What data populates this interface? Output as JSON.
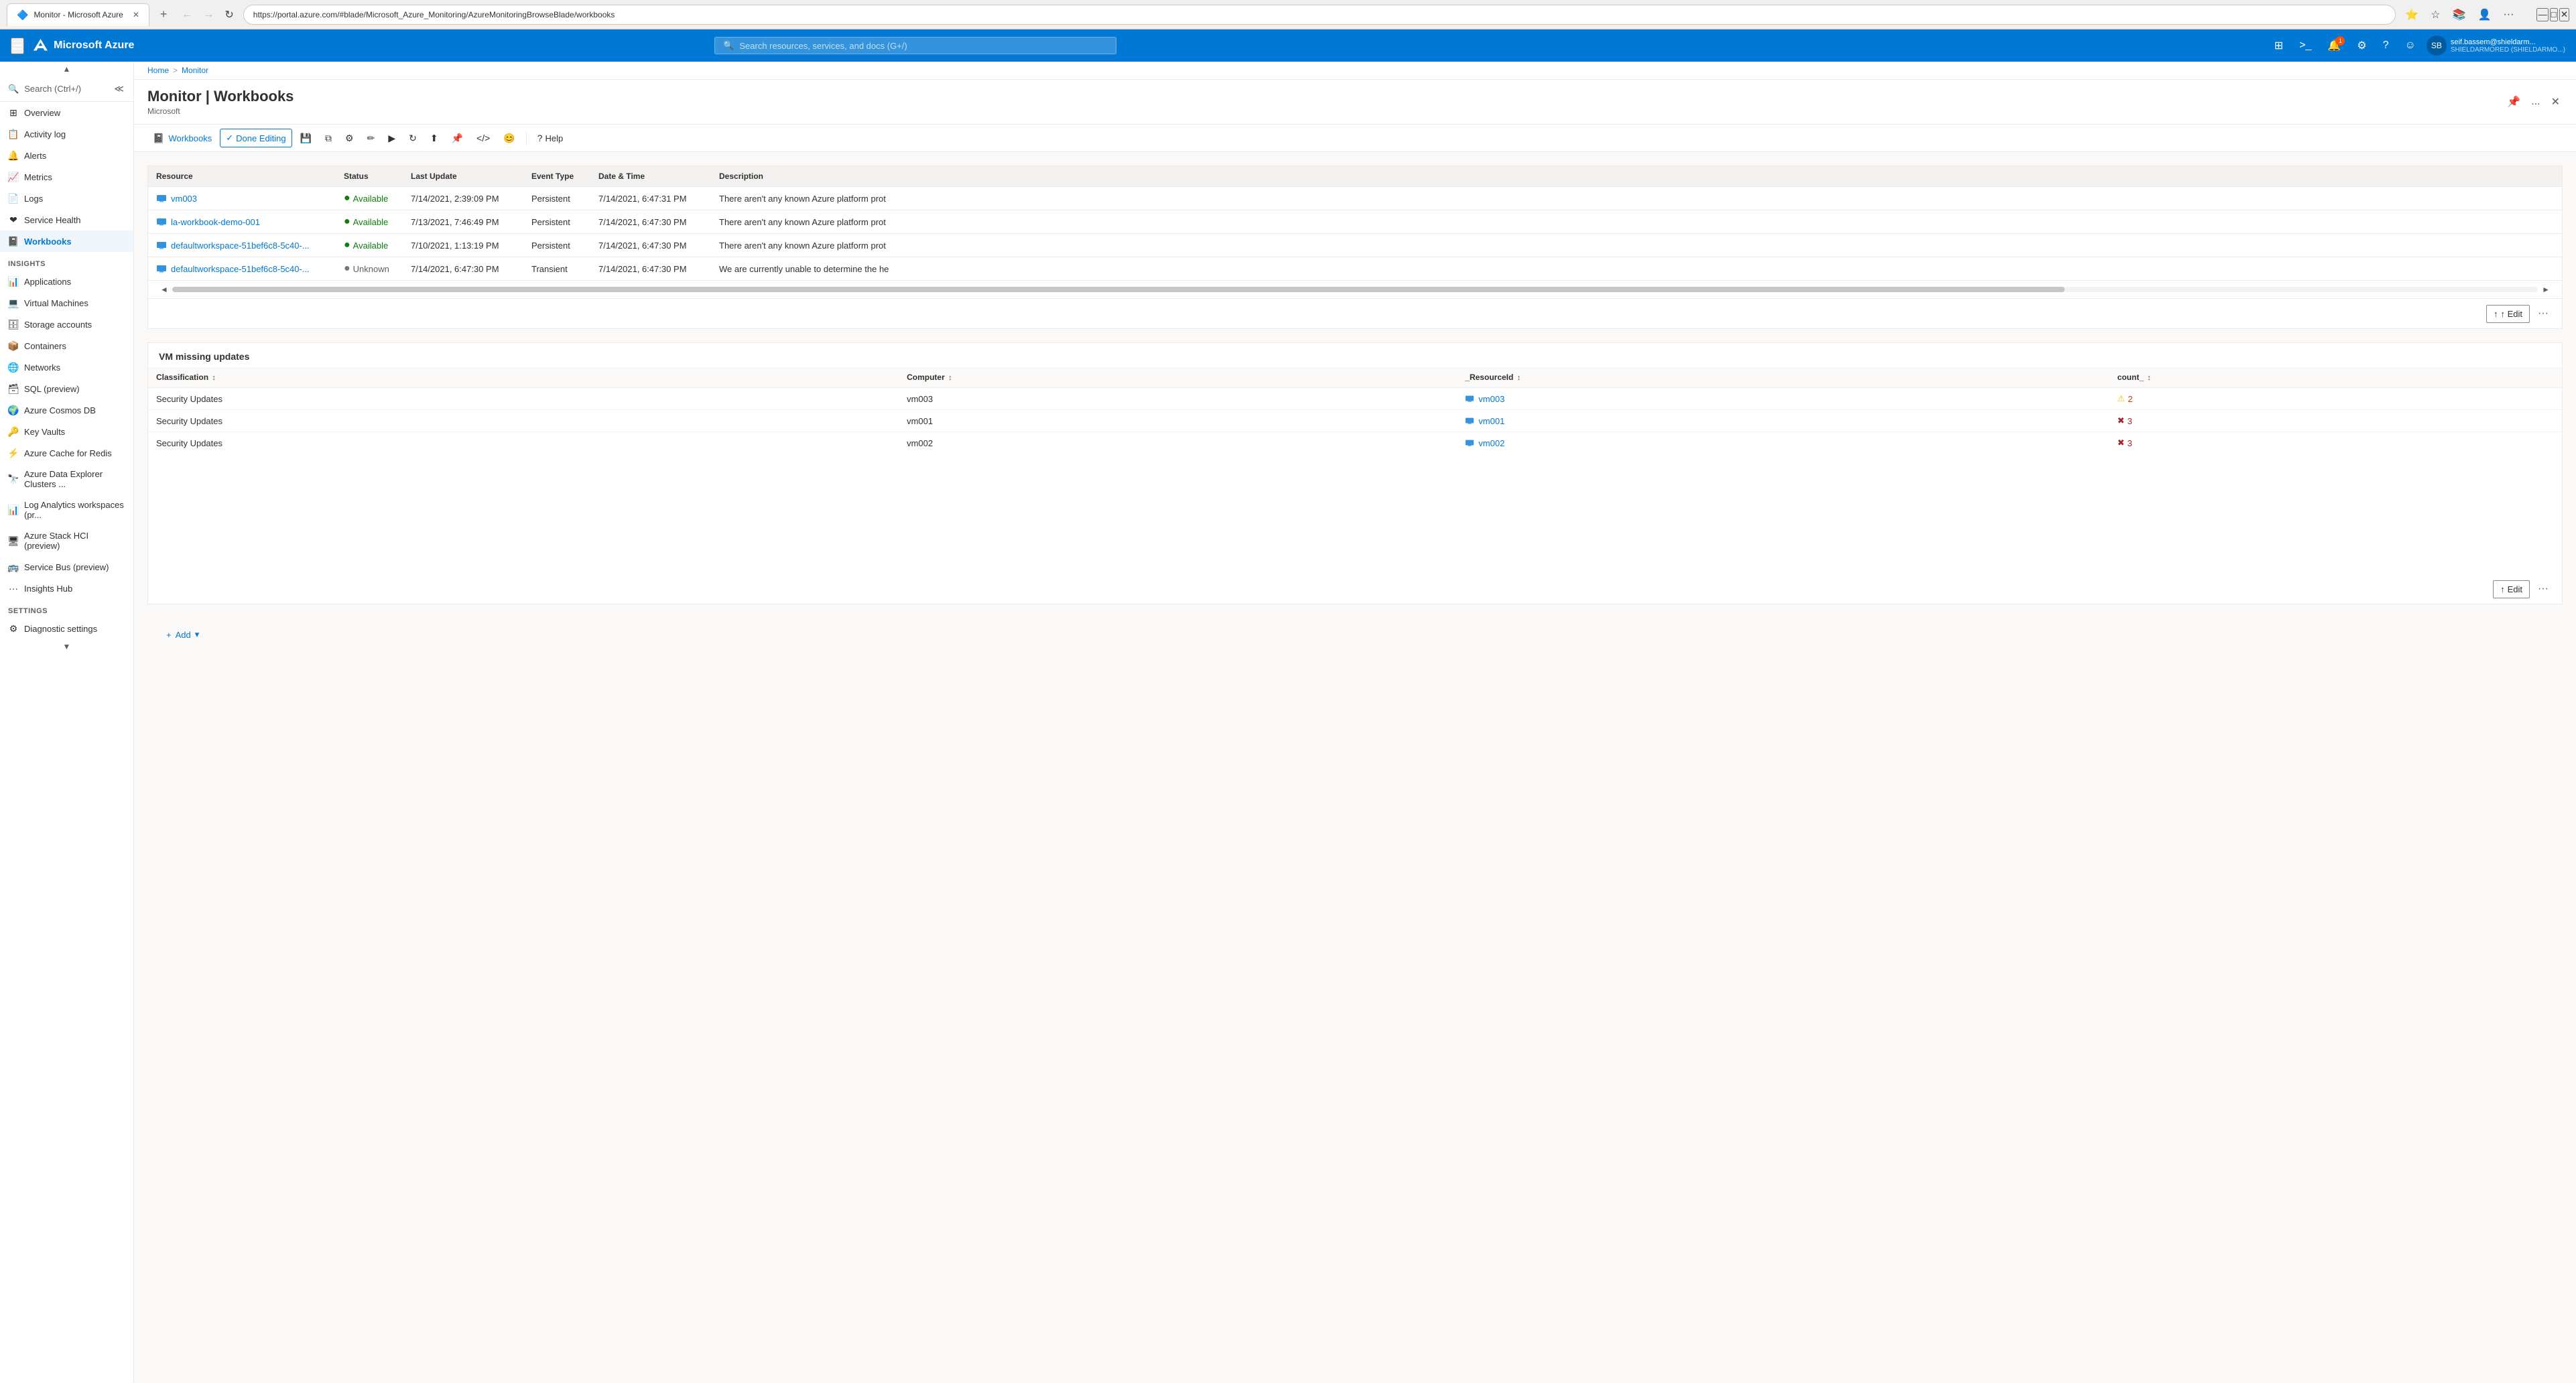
{
  "browser": {
    "tab_title": "Monitor - Microsoft Azure",
    "tab_favicon": "🔷",
    "url": "https://portal.azure.com/#blade/Microsoft_Azure_Monitoring/AzureMonitoringBrowseBlade/workbooks",
    "close_label": "✕",
    "add_tab_label": "+",
    "nav_back": "←",
    "nav_forward": "→",
    "nav_refresh": "↻",
    "win_minimize": "—",
    "win_maximize": "□",
    "win_close": "✕"
  },
  "topbar": {
    "menu_icon": "☰",
    "brand": "Microsoft Azure",
    "search_placeholder": "Search resources, services, and docs (G+/)",
    "search_icon": "🔍",
    "portal_icon": "⊞",
    "cloud_shell_icon": ">_",
    "notification_icon": "🔔",
    "notification_count": "1",
    "settings_icon": "⚙",
    "help_icon": "?",
    "feedback_icon": "☺",
    "user_name": "seif.bassem@shieldarm...",
    "user_tenant": "SHIELDARMORED (SHIELDARMO...)",
    "user_initials": "SB"
  },
  "breadcrumb": {
    "items": [
      "Home",
      "Monitor"
    ],
    "separator": ">"
  },
  "page": {
    "title": "Monitor | Workbooks",
    "subtitle": "Microsoft",
    "pin_icon": "📌",
    "more_icon": "...",
    "close_icon": "✕"
  },
  "sidebar": {
    "search_placeholder": "Search (Ctrl+/)",
    "collapse_icon": "≪",
    "scroll_up": "▲",
    "scroll_down": "▼",
    "items": [
      {
        "id": "overview",
        "label": "Overview",
        "icon": "⊞"
      },
      {
        "id": "activity-log",
        "label": "Activity log",
        "icon": "📋"
      },
      {
        "id": "alerts",
        "label": "Alerts",
        "icon": "🔔"
      },
      {
        "id": "metrics",
        "label": "Metrics",
        "icon": "📈"
      },
      {
        "id": "logs",
        "label": "Logs",
        "icon": "📄"
      },
      {
        "id": "service-health",
        "label": "Service Health",
        "icon": "❤"
      },
      {
        "id": "workbooks",
        "label": "Workbooks",
        "icon": "📓",
        "active": true
      }
    ],
    "insights_section": "Insights",
    "insights_items": [
      {
        "id": "applications",
        "label": "Applications",
        "icon": "📊"
      },
      {
        "id": "virtual-machines",
        "label": "Virtual Machines",
        "icon": "💻"
      },
      {
        "id": "storage-accounts",
        "label": "Storage accounts",
        "icon": "🗄"
      },
      {
        "id": "containers",
        "label": "Containers",
        "icon": "📦"
      },
      {
        "id": "networks",
        "label": "Networks",
        "icon": "🌐"
      },
      {
        "id": "sql-preview",
        "label": "SQL (preview)",
        "icon": "🗃"
      },
      {
        "id": "cosmos-db",
        "label": "Azure Cosmos DB",
        "icon": "🌍"
      },
      {
        "id": "key-vaults",
        "label": "Key Vaults",
        "icon": "🔑"
      },
      {
        "id": "cache-for-redis",
        "label": "Azure Cache for Redis",
        "icon": "⚡"
      },
      {
        "id": "data-explorer",
        "label": "Azure Data Explorer Clusters ...",
        "icon": "🔭"
      },
      {
        "id": "log-analytics",
        "label": "Log Analytics workspaces (pr...",
        "icon": "📊"
      },
      {
        "id": "azure-stack",
        "label": "Azure Stack HCI (preview)",
        "icon": "🖥"
      },
      {
        "id": "service-bus",
        "label": "Service Bus (preview)",
        "icon": "🚌"
      },
      {
        "id": "insights-hub",
        "label": "Insights Hub",
        "icon": "💡"
      }
    ],
    "settings_section": "Settings",
    "settings_items": [
      {
        "id": "diagnostic-settings",
        "label": "Diagnostic settings",
        "icon": "⚙"
      }
    ]
  },
  "toolbar": {
    "workbooks_label": "Workbooks",
    "workbooks_icon": "📓",
    "done_editing_label": "Done Editing",
    "done_editing_icon": "✓",
    "save_icon": "💾",
    "copy_icon": "⧉",
    "settings_icon": "⚙",
    "edit_icon": "✏",
    "play_icon": "▶",
    "refresh_icon": "↻",
    "share_icon": "⬆",
    "pin_icon": "📌",
    "code_icon": "</>",
    "emoji_icon": "😊",
    "help_label": "Help",
    "help_icon": "?"
  },
  "service_health_table": {
    "columns": [
      "Resource",
      "Status",
      "Last Update",
      "Event Type",
      "Date & Time",
      "Description"
    ],
    "rows": [
      {
        "resource": "vm003",
        "resource_icon": "vm",
        "status": "Available",
        "status_type": "available",
        "last_update": "7/14/2021, 2:39:09 PM",
        "event_type": "Persistent",
        "date_time": "7/14/2021, 6:47:31 PM",
        "description": "There aren't any known Azure platform prot"
      },
      {
        "resource": "la-workbook-demo-001",
        "resource_icon": "vm",
        "status": "Available",
        "status_type": "available",
        "last_update": "7/13/2021, 7:46:49 PM",
        "event_type": "Persistent",
        "date_time": "7/14/2021, 6:47:30 PM",
        "description": "There aren't any known Azure platform prot"
      },
      {
        "resource": "defaultworkspace-51bef6c8-5c40-...",
        "resource_icon": "vm",
        "status": "Available",
        "status_type": "available",
        "last_update": "7/10/2021, 1:13:19 PM",
        "event_type": "Persistent",
        "date_time": "7/14/2021, 6:47:30 PM",
        "description": "There aren't any known Azure platform prot"
      },
      {
        "resource": "defaultworkspace-51bef6c8-5c40-...",
        "resource_icon": "vm",
        "status": "Unknown",
        "status_type": "unknown",
        "last_update": "7/14/2021, 6:47:30 PM",
        "event_type": "Transient",
        "date_time": "7/14/2021, 6:47:30 PM",
        "description": "We are currently unable to determine the he"
      }
    ]
  },
  "edit_button": "↑ Edit",
  "more_button": "···",
  "vm_updates": {
    "title": "VM missing updates",
    "columns": [
      {
        "key": "classification",
        "label": "Classification"
      },
      {
        "key": "computer",
        "label": "Computer"
      },
      {
        "key": "resource_id",
        "label": "_ResourceId"
      },
      {
        "key": "count",
        "label": "count_"
      }
    ],
    "rows": [
      {
        "classification": "Security Updates",
        "computer": "vm003",
        "resource": "vm003",
        "resource_link": true,
        "count": "2",
        "count_type": "warning"
      },
      {
        "classification": "Security Updates",
        "computer": "vm001",
        "resource": "vm001",
        "resource_link": true,
        "count": "3",
        "count_type": "error"
      },
      {
        "classification": "Security Updates",
        "computer": "vm002",
        "resource": "vm002",
        "resource_link": true,
        "count": "3",
        "count_type": "error"
      }
    ]
  },
  "add_button": "+ Add ▾",
  "sort_icon": "↕",
  "warning_icon": "⚠",
  "error_icon": "✖"
}
